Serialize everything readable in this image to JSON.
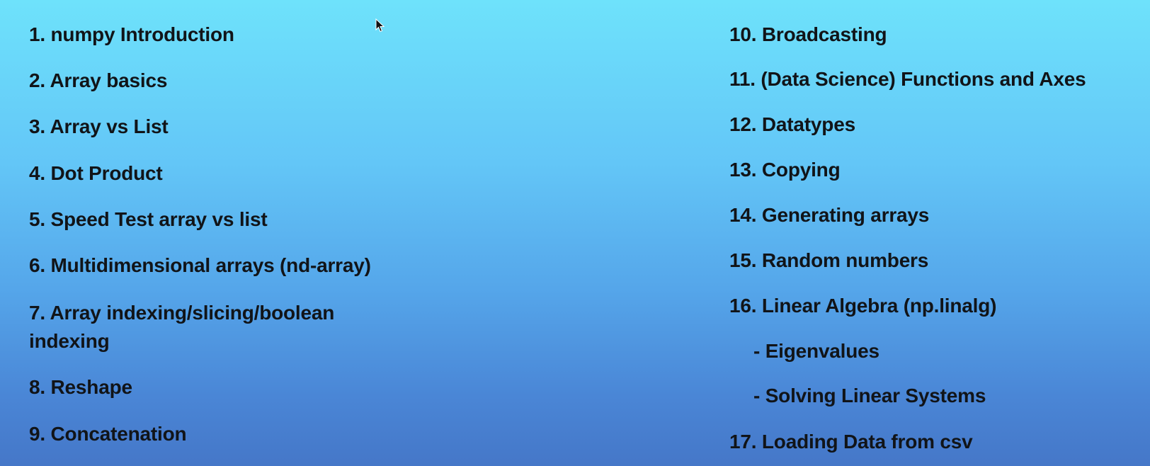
{
  "left_column": [
    "1.  numpy Introduction",
    "2. Array basics",
    "3. Array vs List",
    "4. Dot Product",
    "5. Speed Test array vs list",
    "6. Multidimensional arrays (nd-array)",
    "7. Array indexing/slicing/boolean indexing",
    "8. Reshape",
    "9. Concatenation"
  ],
  "right_column": [
    "10. Broadcasting",
    "11. (Data Science) Functions and Axes",
    "12. Datatypes",
    "13. Copying",
    "14. Generating arrays",
    "15.  Random numbers",
    "16. Linear Algebra (np.linalg)",
    "- Eigenvalues",
    "- Solving Linear Systems",
    "17.  Loading Data from csv"
  ],
  "cursor": "mouse-pointer-icon"
}
